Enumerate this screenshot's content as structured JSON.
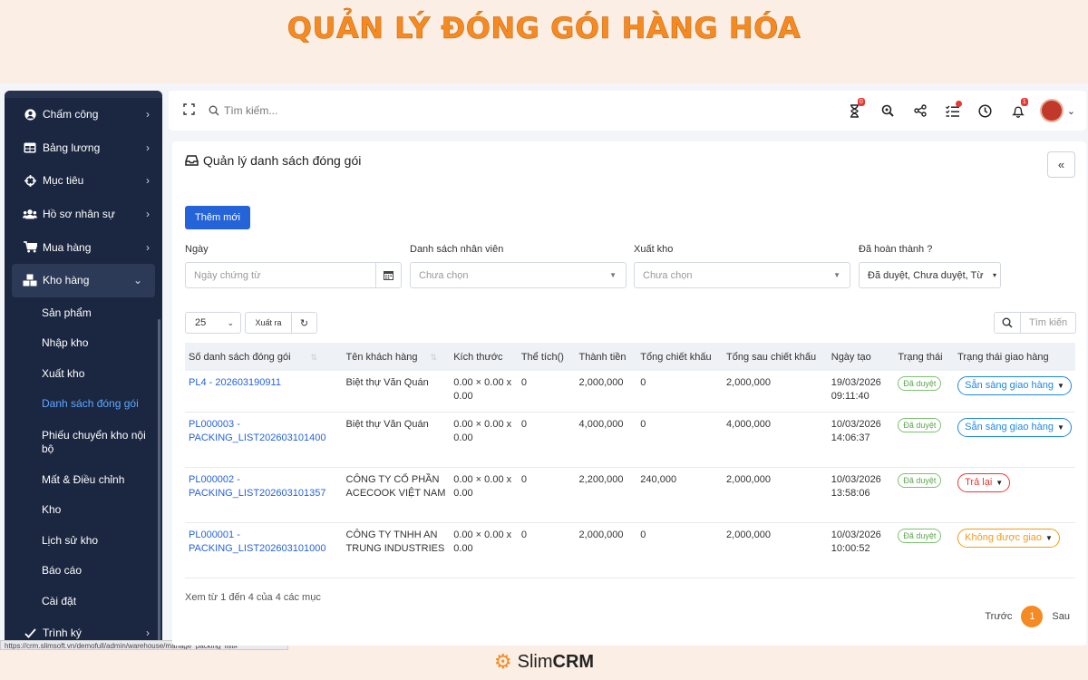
{
  "banner_title": "QUẢN LÝ ĐÓNG GÓI HÀNG HÓA",
  "sidebar": {
    "items": [
      {
        "label": "Chấm công",
        "icon": "user-circle-icon"
      },
      {
        "label": "Bảng lương",
        "icon": "table-icon"
      },
      {
        "label": "Mục tiêu",
        "icon": "target-icon"
      },
      {
        "label": "Hồ sơ nhân sự",
        "icon": "users-icon"
      },
      {
        "label": "Mua hàng",
        "icon": "cart-icon"
      },
      {
        "label": "Kho hàng",
        "icon": "cubes-icon"
      }
    ],
    "sub_items": [
      "Sản phẩm",
      "Nhập kho",
      "Xuất kho",
      "Danh sách đóng gói",
      "Phiếu chuyển kho nội bộ",
      "Mất & Điều chỉnh",
      "Kho",
      "Lịch sử kho",
      "Báo cáo",
      "Cài đặt"
    ],
    "bottom_item": "Trình ký"
  },
  "status_url": "https://crm.slimsoft.vn/demofull/admin/warehouse/manage_packing_list#",
  "topbar": {
    "search_placeholder": "Tìm kiếm...",
    "hourglass_badge": "0",
    "bell_badge": "1"
  },
  "panel": {
    "title": "Quản lý danh sách đóng gói",
    "add_button": "Thêm mới"
  },
  "filters": {
    "date_label": "Ngày",
    "date_placeholder": "Ngày chứng từ",
    "staff_label": "Danh sách nhân viên",
    "staff_value": "Chưa chọn",
    "export_label": "Xuất kho",
    "export_value": "Chưa chọn",
    "done_label": "Đã hoàn thành ?",
    "done_value": "Đã duyệt, Chưa duyệt, Từ"
  },
  "table_tools": {
    "page_size": "25",
    "export_button": "Xuất ra",
    "search_placeholder": "Tìm kiến"
  },
  "table": {
    "headers": [
      "Số danh sách đóng gói",
      "Tên khách hàng",
      "Kích thước",
      "Thể tích()",
      "Thành tiền",
      "Tổng chiết khấu",
      "Tổng sau chiết khấu",
      "Ngày tạo",
      "Trạng thái",
      "Trạng thái giao hàng"
    ],
    "rows": [
      {
        "code": "PL4 - 202603190911",
        "customer": "Biệt thự Văn Quán",
        "size": "0.00 × 0.00 x 0.00",
        "volume": "0",
        "amount": "2,000,000",
        "discount": "0",
        "after": "2,000,000",
        "date": "19/03/2026 09:11:40",
        "status": "Đã duyệt",
        "delivery": "Sẵn sàng giao hàng",
        "delivery_color": "blue"
      },
      {
        "code": "PL000003 - PACKING_LIST202603101400",
        "customer": "Biệt thự Văn Quán",
        "size": "0.00 × 0.00 x 0.00",
        "volume": "0",
        "amount": "4,000,000",
        "discount": "0",
        "after": "4,000,000",
        "date": "10/03/2026 14:06:37",
        "status": "Đã duyệt",
        "delivery": "Sẵn sàng giao hàng",
        "delivery_color": "blue"
      },
      {
        "code": "PL000002 - PACKING_LIST202603101357",
        "customer": "CÔNG TY CỔ PHẦN ACECOOK VIỆT NAM",
        "size": "0.00 × 0.00 x 0.00",
        "volume": "0",
        "amount": "2,200,000",
        "discount": "240,000",
        "after": "2,000,000",
        "date": "10/03/2026 13:58:06",
        "status": "Đã duyệt",
        "delivery": "Trả lại",
        "delivery_color": "red"
      },
      {
        "code": "PL000001 - PACKING_LIST202603101000",
        "customer": "CÔNG TY TNHH AN TRUNG INDUSTRIES",
        "size": "0.00 × 0.00 x 0.00",
        "volume": "0",
        "amount": "2,000,000",
        "discount": "0",
        "after": "2,000,000",
        "date": "10/03/2026 10:00:52",
        "status": "Đã duyệt",
        "delivery": "Không được giao",
        "delivery_color": "orange"
      }
    ]
  },
  "footer": {
    "info": "Xem từ 1 đến 4 của 4 các mục",
    "prev": "Trước",
    "page": "1",
    "next": "Sau"
  },
  "brand": {
    "prefix": "Slim",
    "suffix": "CRM"
  },
  "colors": {
    "accent": "#f58a23",
    "primary": "#2563d8",
    "sidebar": "#1b2741"
  }
}
